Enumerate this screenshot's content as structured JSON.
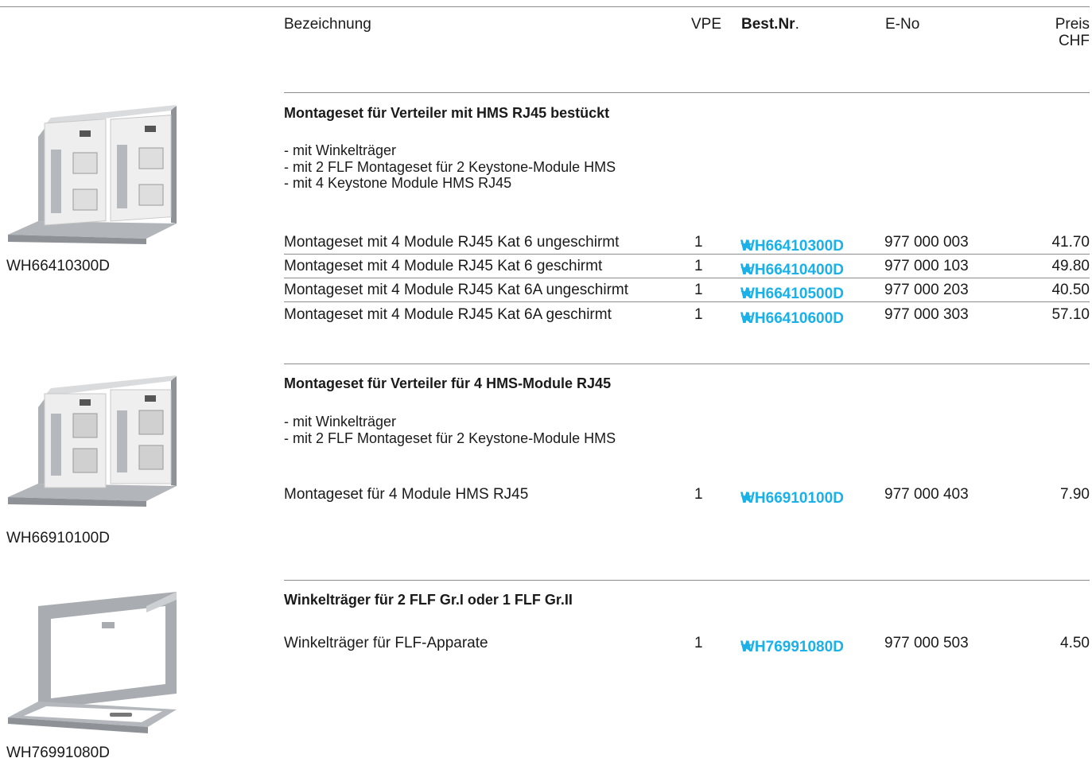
{
  "header": {
    "bezeichnung": "Bezeichnung",
    "vpe": "VPE",
    "bestnr_bold": "Best.Nr",
    "bestnr_dot": ".",
    "eno": "E-No",
    "preis": "Preis",
    "chf": "CHF"
  },
  "sections": [
    {
      "title": "Montageset für Verteiler mit HMS RJ45 bestückt",
      "features": [
        "- mit Winkelträger",
        "- mit 2 FLF Montageset für 2 Keystone-Module HMS",
        "- mit 4 Keystone Module HMS RJ45"
      ],
      "image_label": "WH66410300D",
      "rows": [
        {
          "desc": "Montageset mit 4 Module RJ45 Kat 6 ungeschirmt",
          "vpe": "1",
          "best": "WH66410300D",
          "eno": "977 000 003",
          "price": "41.70"
        },
        {
          "desc": "Montageset mit 4 Module RJ45 Kat 6 geschirmt",
          "vpe": "1",
          "best": "WH66410400D",
          "eno": "977 000 103",
          "price": "49.80"
        },
        {
          "desc": "Montageset mit 4 Module RJ45 Kat 6A ungeschirmt",
          "vpe": "1",
          "best": "WH66410500D",
          "eno": "977 000 203",
          "price": "40.50"
        },
        {
          "desc": "Montageset mit 4 Module RJ45 Kat 6A geschirmt",
          "vpe": "1",
          "best": "WH66410600D",
          "eno": "977 000 303",
          "price": "57.10"
        }
      ]
    },
    {
      "title": "Montageset für Verteiler für 4 HMS-Module RJ45",
      "features": [
        "- mit Winkelträger",
        "- mit 2 FLF Montageset für 2 Keystone-Module HMS"
      ],
      "image_label": "WH66910100D",
      "rows": [
        {
          "desc": "Montageset für 4 Module HMS RJ45",
          "vpe": "1",
          "best": "WH66910100D",
          "eno": "977 000 403",
          "price": "7.90"
        }
      ]
    },
    {
      "title": "Winkelträger für 2 FLF Gr.I oder 1 FLF Gr.II",
      "features": [],
      "image_label": "WH76991080D",
      "rows": [
        {
          "desc": "Winkelträger für FLF-Apparate",
          "vpe": "1",
          "best": "WH76991080D",
          "eno": "977 000 503",
          "price": "4.50"
        }
      ]
    }
  ],
  "star_icon": "★",
  "colors": {
    "order_number": "#1ab0e8",
    "rule": "#8c8c8c"
  }
}
